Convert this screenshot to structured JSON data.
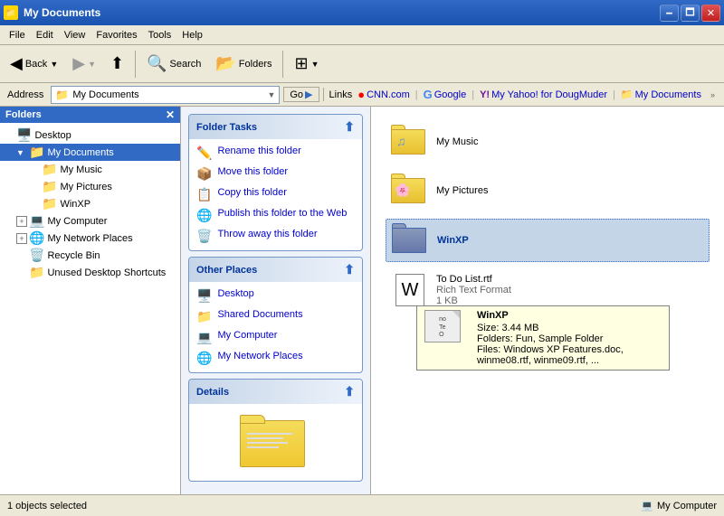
{
  "titlebar": {
    "icon": "📁",
    "title": "My Documents",
    "minimize": "🗕",
    "maximize": "🗖",
    "close": "✕"
  },
  "menubar": {
    "items": [
      "File",
      "Edit",
      "View",
      "Favorites",
      "Tools",
      "Help"
    ]
  },
  "toolbar": {
    "back": "Back",
    "forward": "",
    "up": "",
    "search": "Search",
    "folders": "Folders"
  },
  "address": {
    "label": "Address",
    "value": "My Documents",
    "go": "Go"
  },
  "links": {
    "label": "Links",
    "items": [
      {
        "label": "CNN.com",
        "prefix": "CNN"
      },
      {
        "label": "Google"
      },
      {
        "label": "My Yahoo! for DougMuder"
      },
      {
        "label": "My Documents"
      }
    ]
  },
  "leftpanel": {
    "title": "Folders",
    "tree": [
      {
        "label": "Desktop",
        "icon": "🖥️",
        "indent": 0,
        "expand": ""
      },
      {
        "label": "My Documents",
        "icon": "📁",
        "indent": 1,
        "expand": "▼",
        "selected": true
      },
      {
        "label": "My Music",
        "icon": "📁",
        "indent": 2,
        "expand": ""
      },
      {
        "label": "My Pictures",
        "icon": "📁",
        "indent": 2,
        "expand": ""
      },
      {
        "label": "WinXP",
        "icon": "📁",
        "indent": 2,
        "expand": ""
      },
      {
        "label": "My Computer",
        "icon": "💻",
        "indent": 1,
        "expand": "⊞"
      },
      {
        "label": "My Network Places",
        "icon": "🌐",
        "indent": 1,
        "expand": "⊞"
      },
      {
        "label": "Recycle Bin",
        "icon": "🗑️",
        "indent": 1,
        "expand": ""
      },
      {
        "label": "Unused Desktop Shortcuts",
        "icon": "📁",
        "indent": 1,
        "expand": ""
      }
    ]
  },
  "foldertasks": {
    "title": "Folder Tasks",
    "items": [
      {
        "icon": "✏️",
        "label": "Rename this folder"
      },
      {
        "icon": "📦",
        "label": "Move this folder"
      },
      {
        "icon": "📋",
        "label": "Copy this folder"
      },
      {
        "icon": "🌐",
        "label": "Publish this folder to the Web"
      },
      {
        "icon": "🗑️",
        "label": "Throw away this folder"
      }
    ]
  },
  "otherplaces": {
    "title": "Other Places",
    "items": [
      {
        "icon": "🖥️",
        "label": "Desktop"
      },
      {
        "icon": "📁",
        "label": "Shared Documents"
      },
      {
        "icon": "💻",
        "label": "My Computer"
      },
      {
        "icon": "🌐",
        "label": "My Network Places"
      }
    ]
  },
  "details": {
    "title": "Details"
  },
  "content": {
    "files": [
      {
        "icon": "🎵",
        "label": "My Music",
        "type": "folder"
      },
      {
        "icon": "🖼️",
        "label": "My Pictures",
        "type": "folder"
      },
      {
        "icon": "📁",
        "label": "WinXP",
        "type": "folder"
      },
      {
        "icon": "📄",
        "label": "To Do List.rtf",
        "sublabel": "Rich Text Format\n1 KB",
        "type": "file"
      }
    ]
  },
  "tooltip": {
    "title": "WinXP",
    "size": "Size: 3.44 MB",
    "folders": "Folders: Fun, Sample Folder",
    "files": "Files: Windows XP Features.doc, winme08.rtf, winme09.rtf, ..."
  },
  "statusbar": {
    "left": "1 objects selected",
    "right": "My Computer",
    "icon": "💻"
  }
}
